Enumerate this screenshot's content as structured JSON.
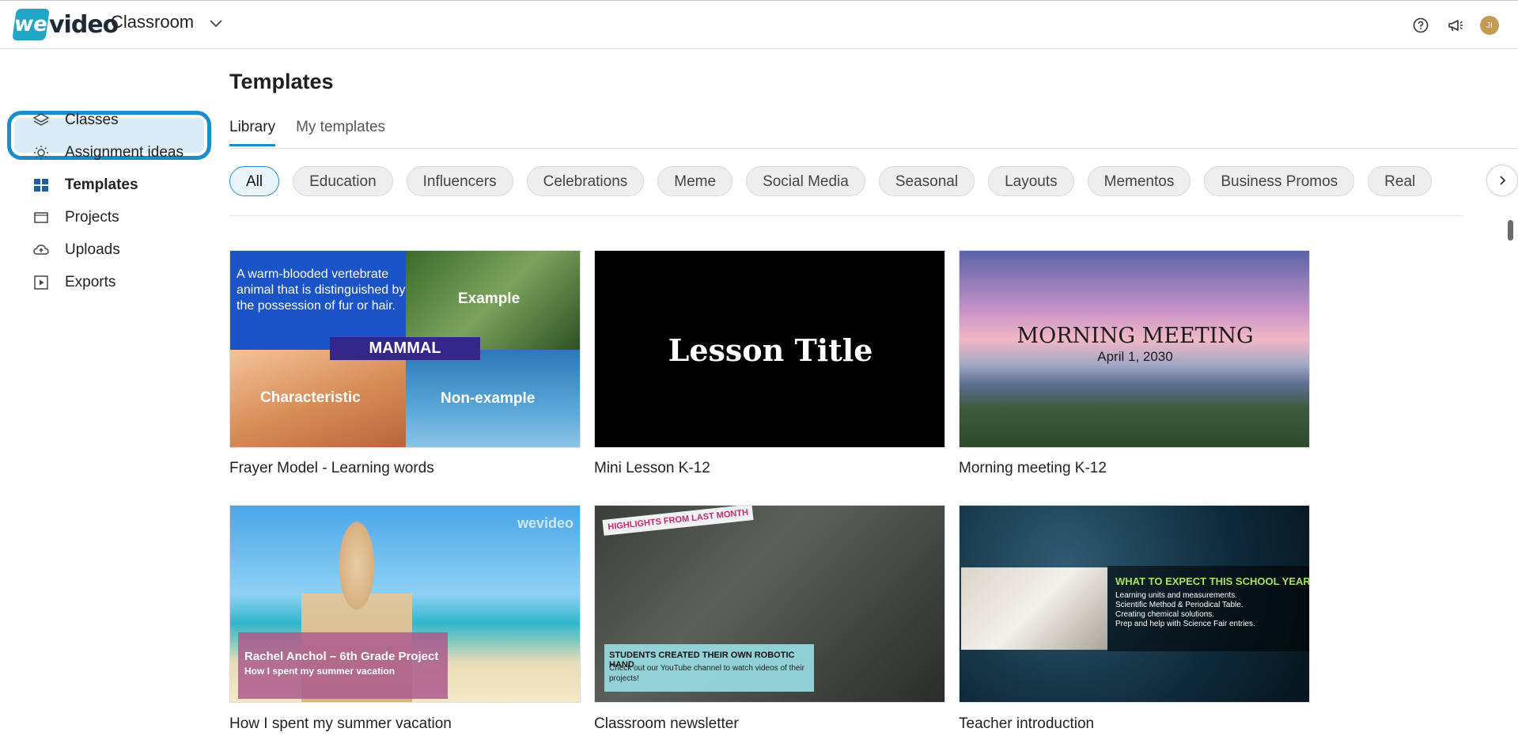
{
  "header": {
    "logo_we": "we",
    "logo_video": "video",
    "app_name": "Classroom",
    "help_icon": "help-icon",
    "announce_icon": "megaphone-icon",
    "avatar_initials": "JI"
  },
  "sidebar": {
    "items": [
      {
        "label": "Classes",
        "icon": "layers-icon"
      },
      {
        "label": "Assignment ideas",
        "icon": "lightbulb-icon"
      },
      {
        "label": "Templates",
        "icon": "grid-icon",
        "active": true
      },
      {
        "label": "Projects",
        "icon": "folder-icon"
      },
      {
        "label": "Uploads",
        "icon": "cloud-upload-icon"
      },
      {
        "label": "Exports",
        "icon": "export-icon"
      }
    ]
  },
  "main": {
    "title": "Templates",
    "tabs": [
      {
        "label": "Library",
        "active": true
      },
      {
        "label": "My templates",
        "active": false
      }
    ],
    "filters": [
      "All",
      "Education",
      "Influencers",
      "Celebrations",
      "Meme",
      "Social Media",
      "Seasonal",
      "Layouts",
      "Mementos",
      "Business Promos",
      "Real"
    ],
    "cards": [
      {
        "title": "Frayer Model - Learning words",
        "thumb": {
          "definition": "A warm-blooded vertebrate animal that is distinguished by the possession of fur or hair.",
          "example": "Example",
          "word": "MAMMAL",
          "characteristic": "Characteristic",
          "non_example": "Non-example"
        }
      },
      {
        "title": "Mini Lesson K-12",
        "thumb": {
          "heading": "Lesson Title"
        }
      },
      {
        "title": "Morning meeting K-12",
        "thumb": {
          "heading": "MORNING MEETING",
          "date": "April 1, 2030"
        }
      },
      {
        "title": "How I spent my summer vacation",
        "thumb": {
          "name_line": "Rachel Anchol – 6th Grade Project",
          "sub_line": "How I spent my summer vacation",
          "watermark": "wevideo"
        }
      },
      {
        "title": "Classroom newsletter",
        "thumb": {
          "badge": "HIGHLIGHTS FROM LAST MONTH",
          "caption_title": "STUDENTS CREATED THEIR OWN ROBOTIC HAND",
          "caption_body": "Check out our YouTube channel to watch videos of their projects!"
        }
      },
      {
        "title": "Teacher introduction",
        "thumb": {
          "heading": "WHAT TO EXPECT THIS SCHOOL YEAR",
          "lines": [
            "Learning units and measurements.",
            "Scientific Method & Periodical Table.",
            "Creating chemical solutions.",
            "Prep and help with Science Fair entries."
          ]
        }
      }
    ]
  },
  "colors": {
    "accent": "#1a8ecc",
    "active_bg": "#d9ecf7",
    "chip_bg": "#eeeeee",
    "brand": "#22a6c8"
  }
}
